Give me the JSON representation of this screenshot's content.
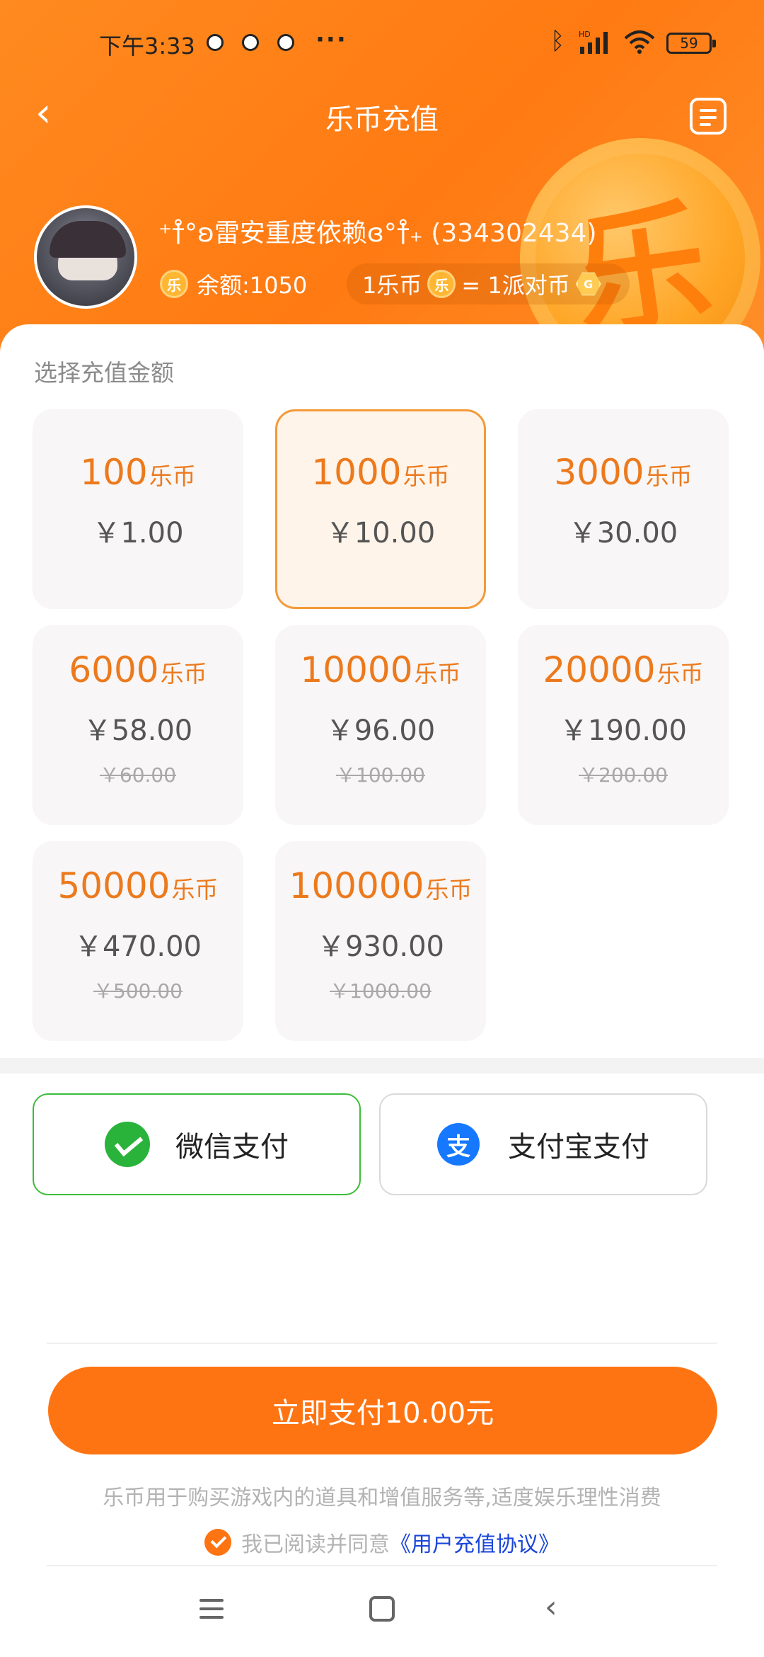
{
  "status_bar": {
    "time": "下午3:33",
    "more": "···",
    "bluetooth": "ᛒ",
    "network": "HD",
    "battery": "59"
  },
  "header": {
    "back_icon": "‹",
    "title": "乐币充值",
    "coin_glyph": "乐"
  },
  "user": {
    "name": "⁺†̊°ʚ雷安重度依赖ɞ°†̊₊",
    "uid": "(334302434)"
  },
  "balance": {
    "coin_icon": "乐",
    "label": "余额:1050"
  },
  "rate": {
    "left": "1乐币",
    "coin_icon": "乐",
    "middle": "= 1派对币",
    "party_icon": "G"
  },
  "packages_label": "选择充值金额",
  "packages": [
    {
      "coins": "100",
      "unit": "乐币",
      "price": "￥1.00",
      "original": ""
    },
    {
      "coins": "1000",
      "unit": "乐币",
      "price": "￥10.00",
      "original": ""
    },
    {
      "coins": "3000",
      "unit": "乐币",
      "price": "￥30.00",
      "original": ""
    },
    {
      "coins": "6000",
      "unit": "乐币",
      "price": "￥58.00",
      "original": "￥60.00"
    },
    {
      "coins": "10000",
      "unit": "乐币",
      "price": "￥96.00",
      "original": "￥100.00"
    },
    {
      "coins": "20000",
      "unit": "乐币",
      "price": "￥190.00",
      "original": "￥200.00"
    },
    {
      "coins": "50000",
      "unit": "乐币",
      "price": "￥470.00",
      "original": "￥500.00"
    },
    {
      "coins": "100000",
      "unit": "乐币",
      "price": "￥930.00",
      "original": "￥1000.00"
    }
  ],
  "selected_package": "1000",
  "payment": {
    "wechat": "微信支付",
    "alipay": "支付宝支付",
    "alipay_icon": "支",
    "selected": "wechat"
  },
  "submit_label": "立即支付10.00元",
  "notice": "乐币用于购买游戏内的道具和增值服务等,适度娱乐理性消费",
  "agreement": {
    "prefix": "我已阅读并同意",
    "link": "《用户充值协议》",
    "checked": true
  },
  "nav": {
    "back_icon": "‹"
  },
  "colors": {
    "accent": "#ff7412",
    "header": "#ff8a1f",
    "wechat": "#29b33a",
    "alipay": "#1677ff",
    "coin_text": "#ec7a1d",
    "link": "#1a46d8"
  }
}
